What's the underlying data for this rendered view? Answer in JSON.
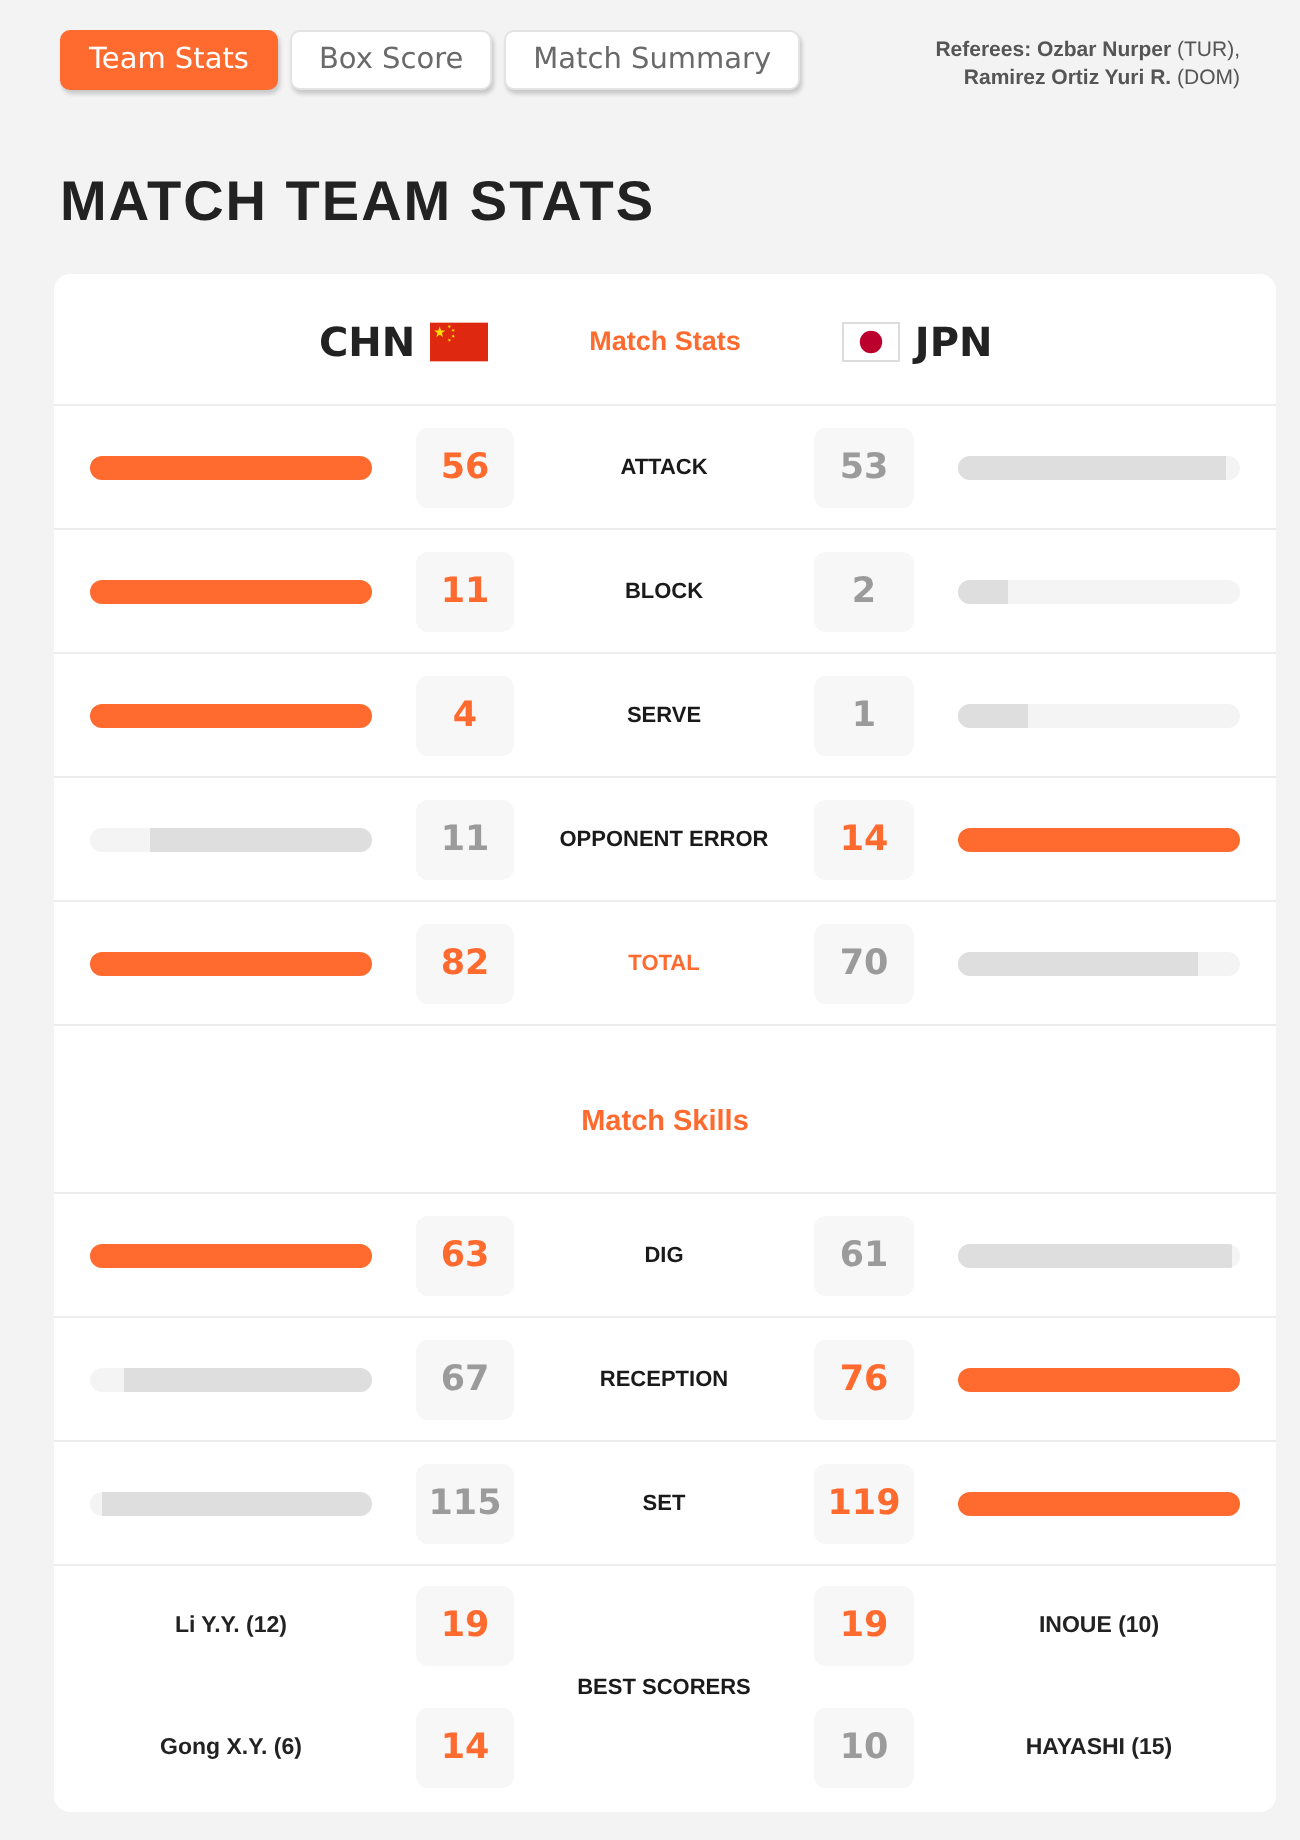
{
  "tabs": [
    {
      "label": "Team Stats",
      "selected": true
    },
    {
      "label": "Box Score",
      "selected": false
    },
    {
      "label": "Match Summary",
      "selected": false
    }
  ],
  "referees": [
    "**Referees: Ozbar Nurper** (TUR),",
    "**Ramirez Ortiz Yuri R.** (DOM)"
  ],
  "title": "MATCH TEAM STATS",
  "teams": [
    {
      "code": "CHN",
      "kind": "china"
    },
    {
      "code": "JPN",
      "kind": "japan"
    }
  ],
  "match_stats": {
    "heading": "Match Stats",
    "rows": [
      {
        "label": "ATTACK",
        "kind": "stat",
        "home": {
          "value": "56",
          "leading": true,
          "level": 1
        },
        "away": {
          "value": "53",
          "leading": false,
          "level": 0.95
        }
      },
      {
        "label": "BLOCK",
        "kind": "stat",
        "home": {
          "value": "11",
          "leading": true,
          "level": 1
        },
        "away": {
          "value": "2",
          "leading": false,
          "level": 0.18
        }
      },
      {
        "label": "SERVE",
        "kind": "stat",
        "home": {
          "value": "4",
          "leading": true,
          "level": 1
        },
        "away": {
          "value": "1",
          "leading": false,
          "level": 0.25
        }
      },
      {
        "label": "OPPONENT ERROR",
        "kind": "stat",
        "home": {
          "value": "11",
          "leading": false,
          "level": 0.79
        },
        "away": {
          "value": "14",
          "leading": true,
          "level": 1
        }
      },
      {
        "label": "TOTAL",
        "kind": "total",
        "home": {
          "value": "82",
          "leading": true,
          "level": 1
        },
        "away": {
          "value": "70",
          "leading": false,
          "level": 0.85
        }
      }
    ]
  },
  "match_skills": {
    "heading": "Match Skills",
    "rows": [
      {
        "label": "DIG",
        "kind": "stat",
        "home": {
          "value": "63",
          "leading": true,
          "level": 1
        },
        "away": {
          "value": "61",
          "leading": false,
          "level": 0.97
        }
      },
      {
        "label": "RECEPTION",
        "kind": "stat",
        "home": {
          "value": "67",
          "leading": false,
          "level": 0.88
        },
        "away": {
          "value": "76",
          "leading": true,
          "level": 1
        }
      },
      {
        "label": "SET",
        "kind": "stat",
        "home": {
          "value": "115",
          "leading": false,
          "level": 0.96
        },
        "away": {
          "value": "119",
          "leading": true,
          "level": 1
        }
      }
    ]
  },
  "best_scorers": {
    "label": "BEST SCORERS",
    "rows": [
      {
        "home": {
          "name": "Li Y.Y. (12)",
          "points": "19",
          "leading": true
        },
        "away": {
          "name": "INOUE (10)",
          "points": "19",
          "leading": true
        }
      },
      {
        "home": {
          "name": "Gong X.Y. (6)",
          "points": "14",
          "leading": true
        },
        "away": {
          "name": "HAYASHI (15)",
          "points": "10",
          "leading": false
        }
      }
    ]
  }
}
